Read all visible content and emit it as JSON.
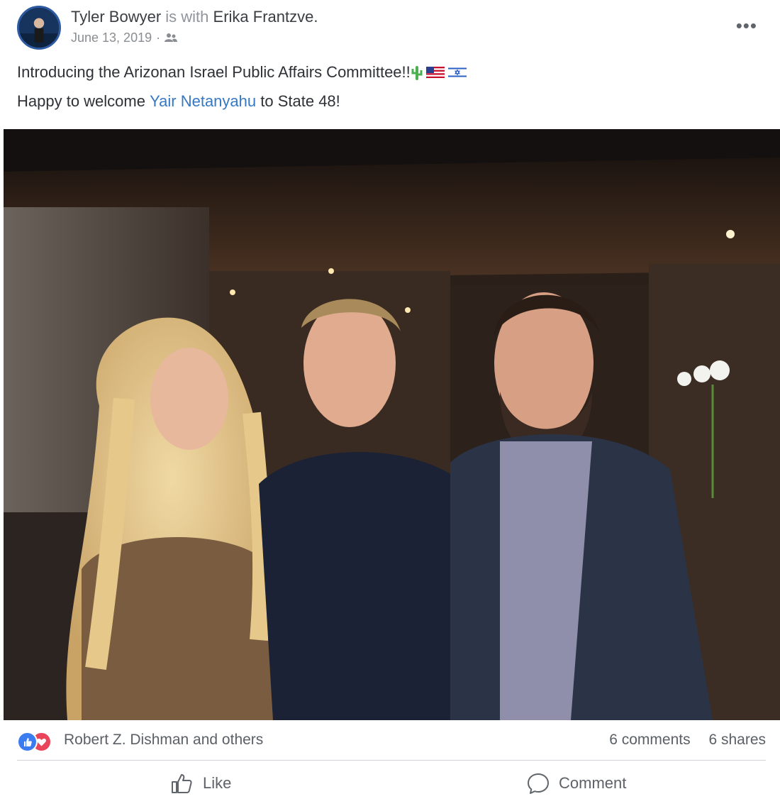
{
  "header": {
    "author": "Tyler Bowyer",
    "with_text": "is with",
    "tagged": "Erika Frantzve.",
    "date": "June 13, 2019",
    "date_sep": "·",
    "privacy_icon": "friends-icon",
    "more_label": "•••"
  },
  "body": {
    "line1": "Introducing the Arizonan Israel Public Affairs Committee!!",
    "line1_emojis": [
      "cactus",
      "us-flag",
      "israel-flag"
    ],
    "line2_before": "Happy to welcome",
    "line2_mention": "Yair Netanyahu",
    "line2_after": "to State 48!"
  },
  "reactions": {
    "icons": [
      "like-icon",
      "love-icon"
    ],
    "text": "Robert Z. Dishman and others",
    "comments": "6 comments",
    "shares": "6 shares"
  },
  "actions": {
    "like": "Like",
    "comment": "Comment"
  },
  "colors": {
    "link": "#3578c4",
    "like_blue": "#3b7df0",
    "love_red": "#e9445a"
  }
}
